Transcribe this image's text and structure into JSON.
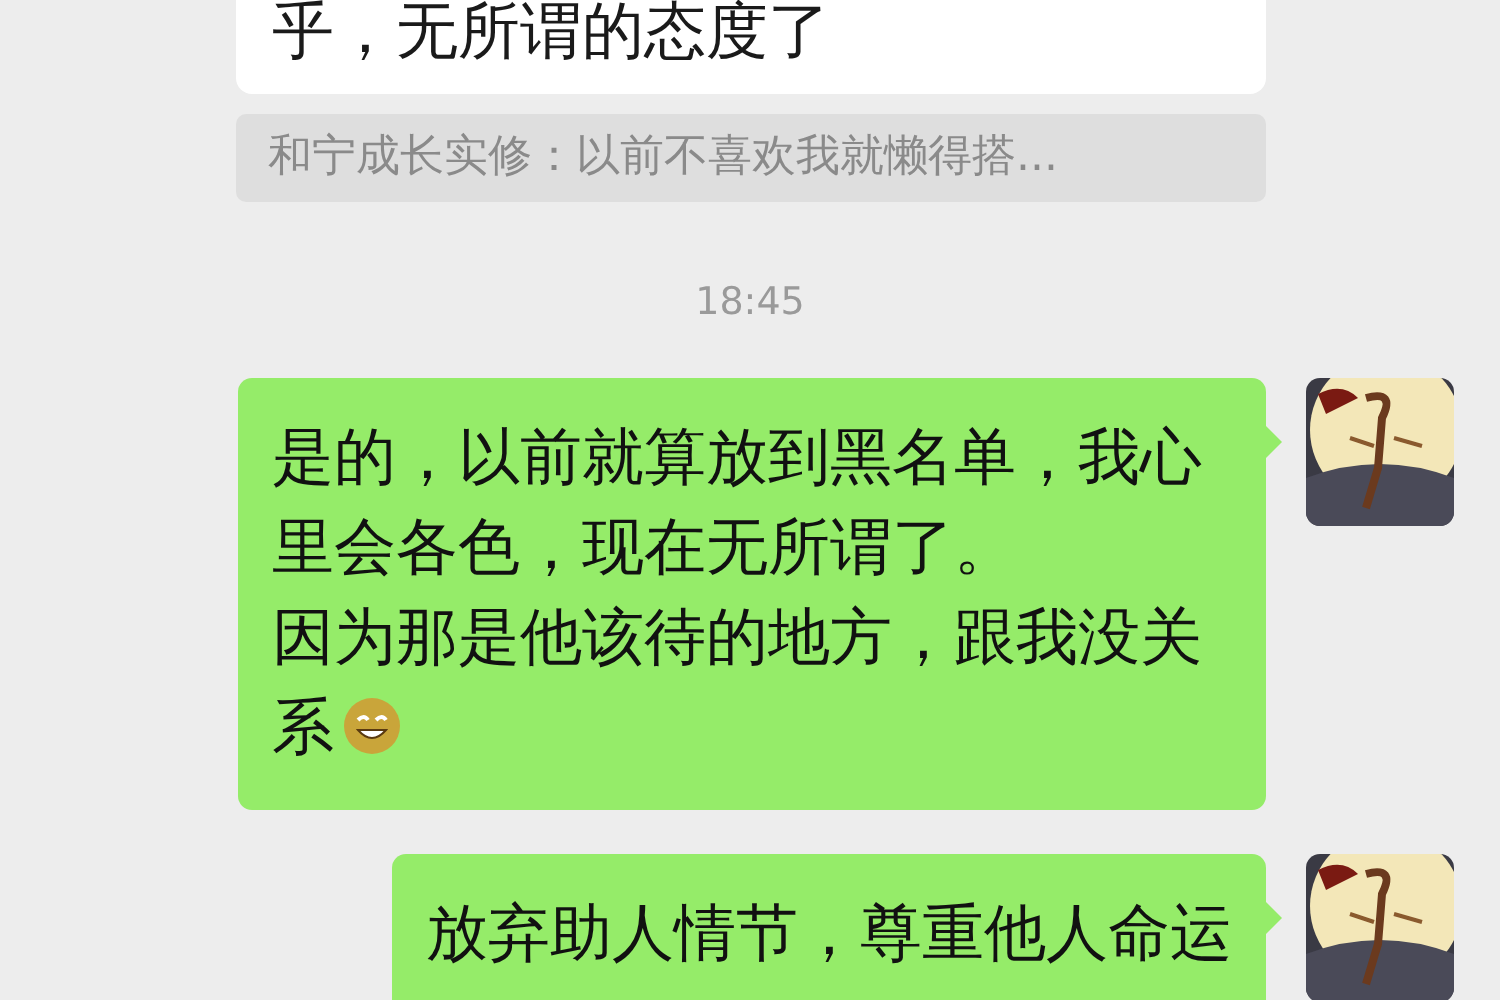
{
  "messages": [
    {
      "kind": "incoming",
      "text": "乎，无所谓的态度了"
    },
    {
      "kind": "quote",
      "text": "和宁成长实修：以前不喜欢我就懒得搭..."
    },
    {
      "kind": "time",
      "text": "18:45"
    },
    {
      "kind": "outgoing",
      "paragraphs": [
        "是的，以前就算放到黑名单，我心里会各色，现在无所谓了。",
        "因为那是他该待的地方，跟我没关系"
      ],
      "emoji": true
    },
    {
      "kind": "outgoing",
      "paragraphs": [
        "放弃助人情节，尊重他人命运"
      ],
      "emoji": false
    }
  ]
}
